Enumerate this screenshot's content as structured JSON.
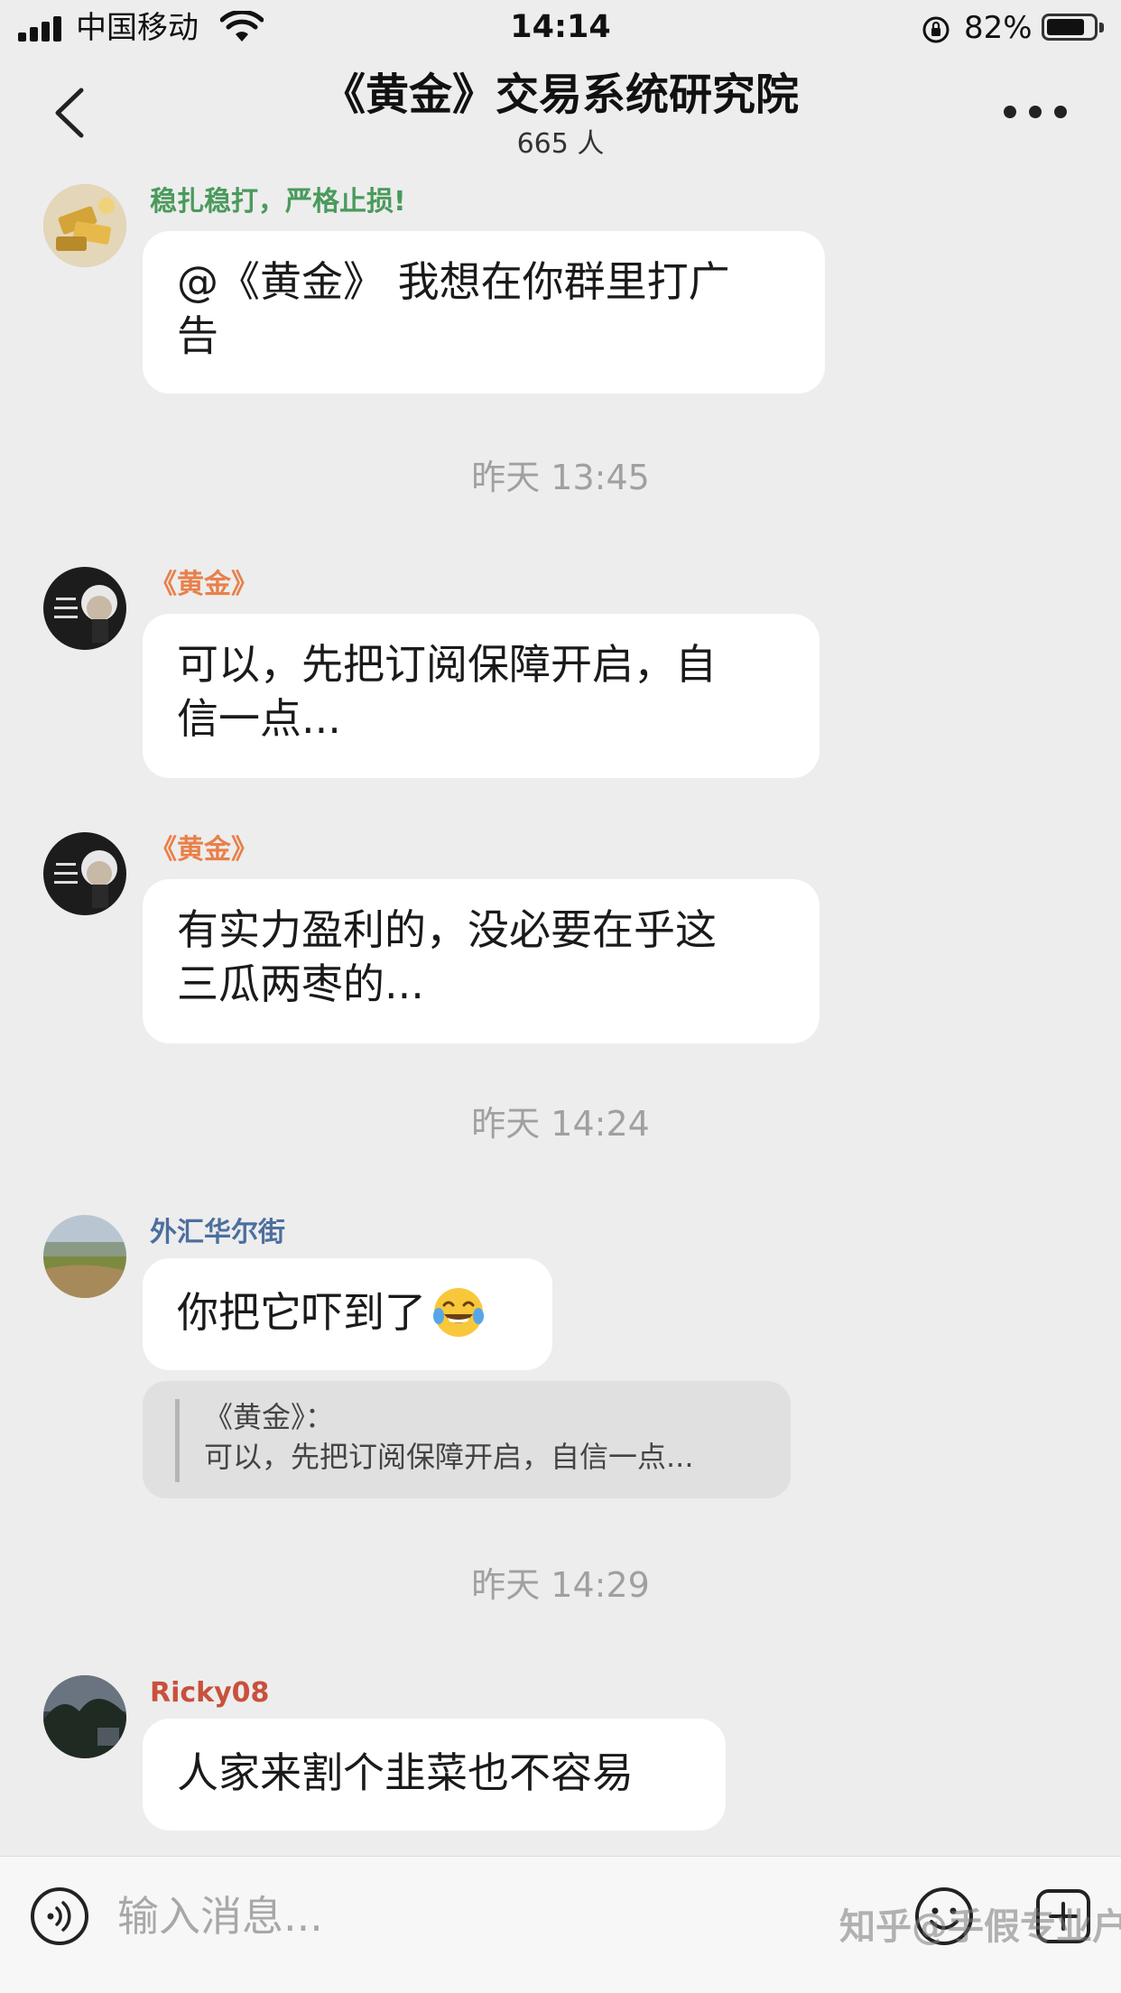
{
  "status_bar": {
    "carrier": "中国移动",
    "time": "14:14",
    "battery_percent": "82%",
    "battery_level": 0.82
  },
  "header": {
    "title": "《黄金》交易系统研究院",
    "member_count": "665 人",
    "back_icon": "chevron-left-icon",
    "more_icon": "more-dots-icon"
  },
  "messages": [
    {
      "sender": "稳扎稳打，严格止损!",
      "sender_color": "#4a9a5c",
      "lines": [
        "@《黄金》 我想在你群里打广",
        "告"
      ]
    },
    {
      "timestamp": "昨天 13:45"
    },
    {
      "sender": "《黄金》",
      "sender_color": "#e8804a",
      "lines": [
        "可以，先把订阅保障开启，自",
        "信一点..."
      ]
    },
    {
      "sender": "《黄金》",
      "sender_color": "#e8804a",
      "lines": [
        "有实力盈利的，没必要在乎这",
        "三瓜两枣的..."
      ]
    },
    {
      "timestamp": "昨天 14:24"
    },
    {
      "sender": "外汇华尔街",
      "sender_color": "#4d6f9f",
      "text": "你把它吓到了",
      "emoji": "laughing-tears-emoji",
      "quote": {
        "author": "《黄金》：",
        "text": "可以，先把订阅保障开启，自信一点..."
      }
    },
    {
      "timestamp": "昨天 14:29"
    },
    {
      "sender": "Ricky08",
      "sender_color": "#c9503c",
      "text": "人家来割个韭菜也不容易"
    }
  ],
  "input_bar": {
    "placeholder": "输入消息...",
    "voice_icon": "voice-icon",
    "emoji_icon": "emoji-icon",
    "plus_icon": "add-icon"
  },
  "watermark": "知乎@手假专业户"
}
